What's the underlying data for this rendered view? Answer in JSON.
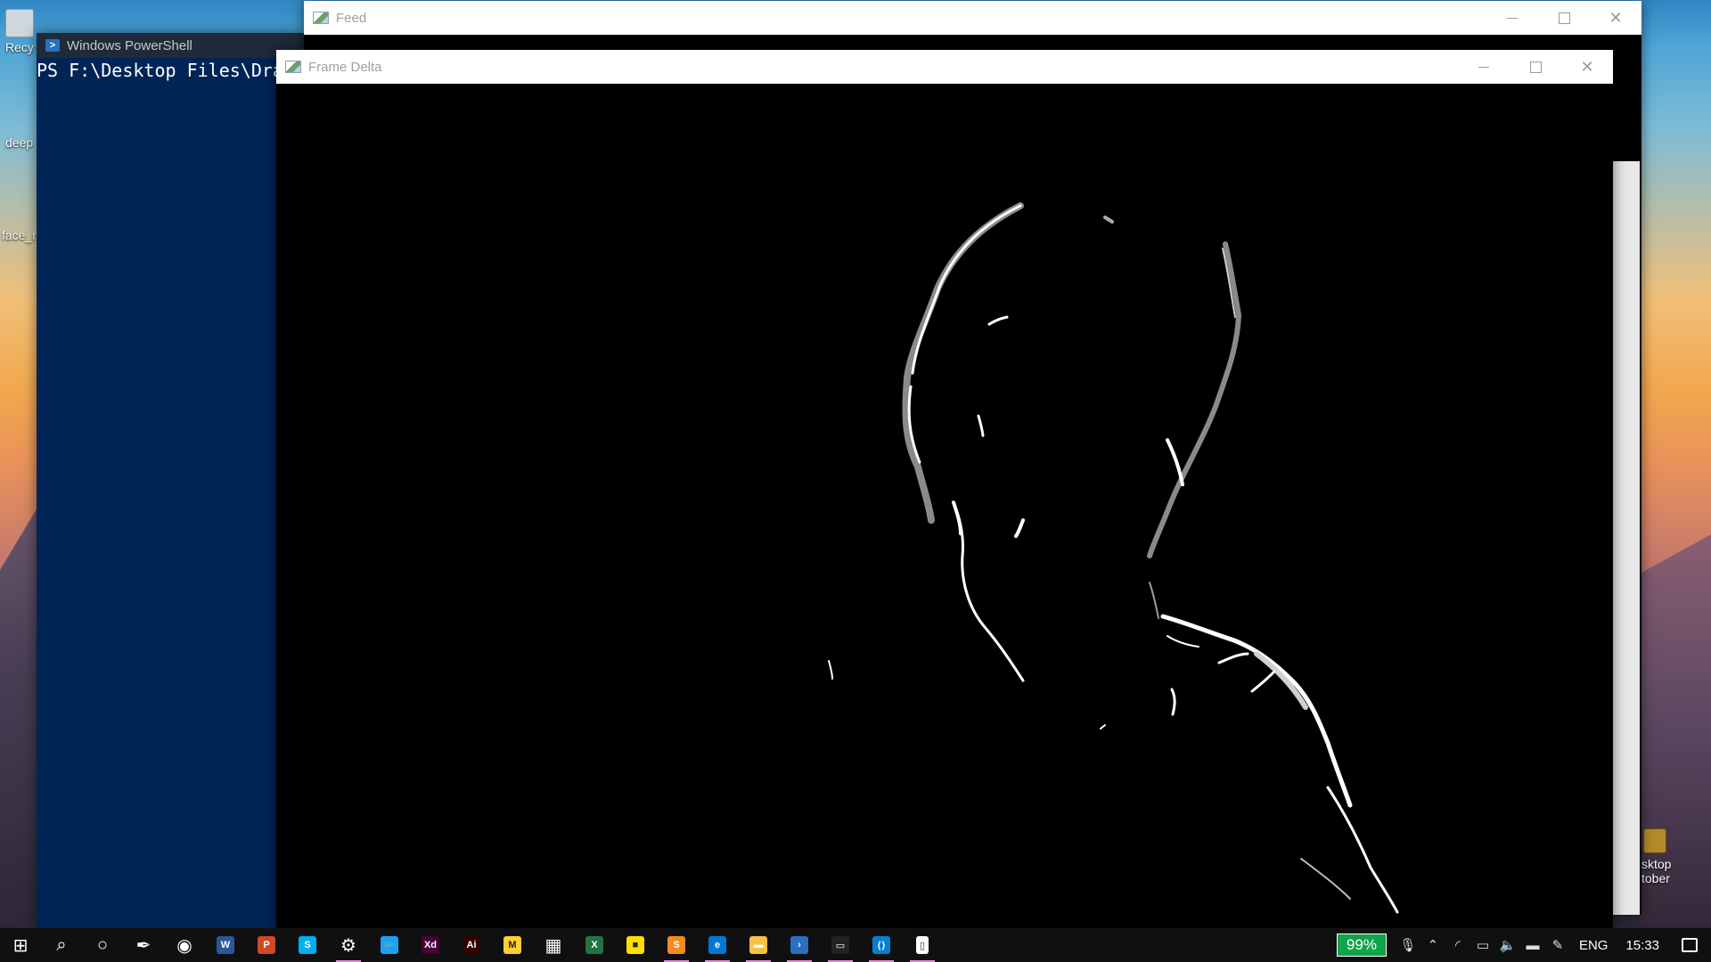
{
  "desktop": {
    "icons": [
      {
        "label": "Recy"
      },
      {
        "label": "deep"
      },
      {
        "label": "face_r"
      },
      {
        "label": "sktop"
      },
      {
        "label": "tober"
      }
    ]
  },
  "powershell": {
    "title": "Windows PowerShell",
    "prompt_text": "PS F:\\Desktop Files\\Dra"
  },
  "feed_window": {
    "title": "Feed"
  },
  "delta_window": {
    "title": "Frame Delta"
  },
  "taskbar": {
    "apps": [
      {
        "name": "start",
        "icon": "windows-logo-icon",
        "open": false
      },
      {
        "name": "search",
        "icon": "search-icon",
        "open": false
      },
      {
        "name": "cortana",
        "icon": "cortana-icon",
        "open": false
      },
      {
        "name": "pen",
        "icon": "pen-icon",
        "open": false
      },
      {
        "name": "chrome",
        "icon": "chrome-icon",
        "open": false
      },
      {
        "name": "word",
        "icon": "word-icon",
        "label": "W",
        "color": "#2b579a",
        "open": false
      },
      {
        "name": "powerpoint",
        "icon": "powerpoint-icon",
        "label": "P",
        "color": "#d24726",
        "open": false
      },
      {
        "name": "skype",
        "icon": "skype-icon",
        "label": "S",
        "color": "#00aff0",
        "open": false
      },
      {
        "name": "settings",
        "icon": "settings-icon",
        "open": true
      },
      {
        "name": "twitter",
        "icon": "twitter-icon",
        "color": "#1da1f2",
        "open": false
      },
      {
        "name": "adobe-xd",
        "icon": "adobe-xd-icon",
        "label": "Xd",
        "color": "#470137",
        "open": false
      },
      {
        "name": "illustrator",
        "icon": "illustrator-icon",
        "label": "Ai",
        "color": "#330000",
        "open": false
      },
      {
        "name": "miro",
        "icon": "miro-icon",
        "color": "#ffd02f",
        "open": false
      },
      {
        "name": "calculator",
        "icon": "calculator-icon",
        "open": false
      },
      {
        "name": "excel",
        "icon": "excel-icon",
        "label": "X",
        "color": "#217346",
        "open": false
      },
      {
        "name": "sticky-notes",
        "icon": "sticky-notes-icon",
        "color": "#ffdf00",
        "open": false
      },
      {
        "name": "sublime",
        "icon": "sublime-icon",
        "label": "S",
        "color": "#f28c1f",
        "open": true
      },
      {
        "name": "edge",
        "icon": "edge-icon",
        "label": "e",
        "color": "#0078d7",
        "open": true
      },
      {
        "name": "file-explorer",
        "icon": "folder-icon",
        "color": "#f5c242",
        "open": true
      },
      {
        "name": "powershell",
        "icon": "powershell-icon",
        "color": "#2a6fc2",
        "open": true
      },
      {
        "name": "terminal",
        "icon": "terminal-icon",
        "color": "#222222",
        "open": true
      },
      {
        "name": "vscode",
        "icon": "vscode-icon",
        "color": "#0a7ecf",
        "open": true
      },
      {
        "name": "notepad",
        "icon": "notepad-icon",
        "color": "#ffffff",
        "open": true
      }
    ],
    "battery_text": "99%",
    "language": "ENG",
    "time": "15:33"
  },
  "colors": {
    "powershell_bg": "#012456",
    "taskbar_bg": "#101010",
    "battery_green": "#0fa34a",
    "open_indicator": "#e68ad6"
  }
}
